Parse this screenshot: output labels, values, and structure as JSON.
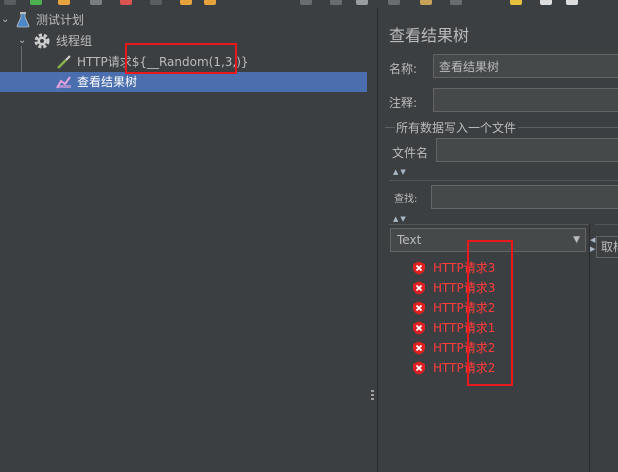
{
  "tree": {
    "test_plan_label": "测试计划",
    "thread_group_label": "线程组",
    "http_sampler_label": "HTTP请求${__Random(1,3,)}",
    "result_tree_label": "查看结果树"
  },
  "panel": {
    "title": "查看结果树",
    "name_label": "名称:",
    "name_value": "查看结果树",
    "comment_label": "注释:",
    "comment_value": "",
    "file_group_label": "所有数据写入一个文件",
    "filename_label": "文件名",
    "filename_value": "",
    "search_label": "查找:",
    "search_value": "",
    "renderer_selected": "Text",
    "tab_label": "取样"
  },
  "results": [
    "HTTP请求3",
    "HTTP请求3",
    "HTTP请求2",
    "HTTP请求1",
    "HTTP请求2",
    "HTTP请求2"
  ],
  "colors": {
    "selection": "#4b6eaf",
    "error_text": "#ff3b3b",
    "highlight_box": "#e8191d"
  },
  "icons": {
    "test_plan": "flask-icon",
    "thread_group": "gear-icon",
    "sampler": "pipette-icon",
    "listener": "chart-icon",
    "result_error": "shield-error-icon"
  }
}
